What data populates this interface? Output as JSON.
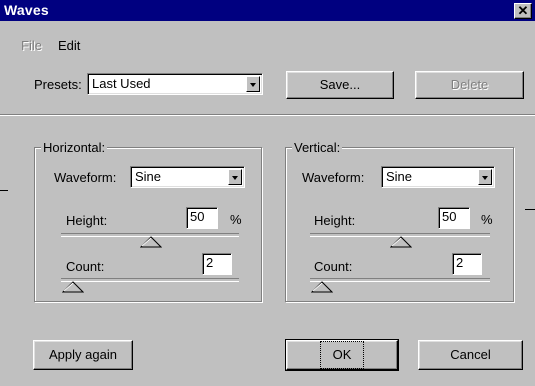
{
  "window": {
    "title": "Waves",
    "close_glyph": "✕"
  },
  "menu": {
    "file": "File",
    "edit": "Edit"
  },
  "presets": {
    "label": "Presets:",
    "value": "Last Used"
  },
  "buttons": {
    "save": "Save...",
    "delete": "Delete",
    "apply_again": "Apply again",
    "ok": "OK",
    "cancel": "Cancel"
  },
  "horizontal": {
    "title": "Horizontal:",
    "waveform_label": "Waveform:",
    "waveform_value": "Sine",
    "height_label": "Height:",
    "height_value": "50",
    "height_unit": "%",
    "count_label": "Count:",
    "count_value": "2"
  },
  "vertical": {
    "title": "Vertical:",
    "waveform_label": "Waveform:",
    "waveform_value": "Sine",
    "height_label": "Height:",
    "height_value": "50",
    "height_unit": "%",
    "count_label": "Count:",
    "count_value": "2"
  },
  "colors": {
    "titlebar": "#000080",
    "face": "#c0c0c0"
  }
}
